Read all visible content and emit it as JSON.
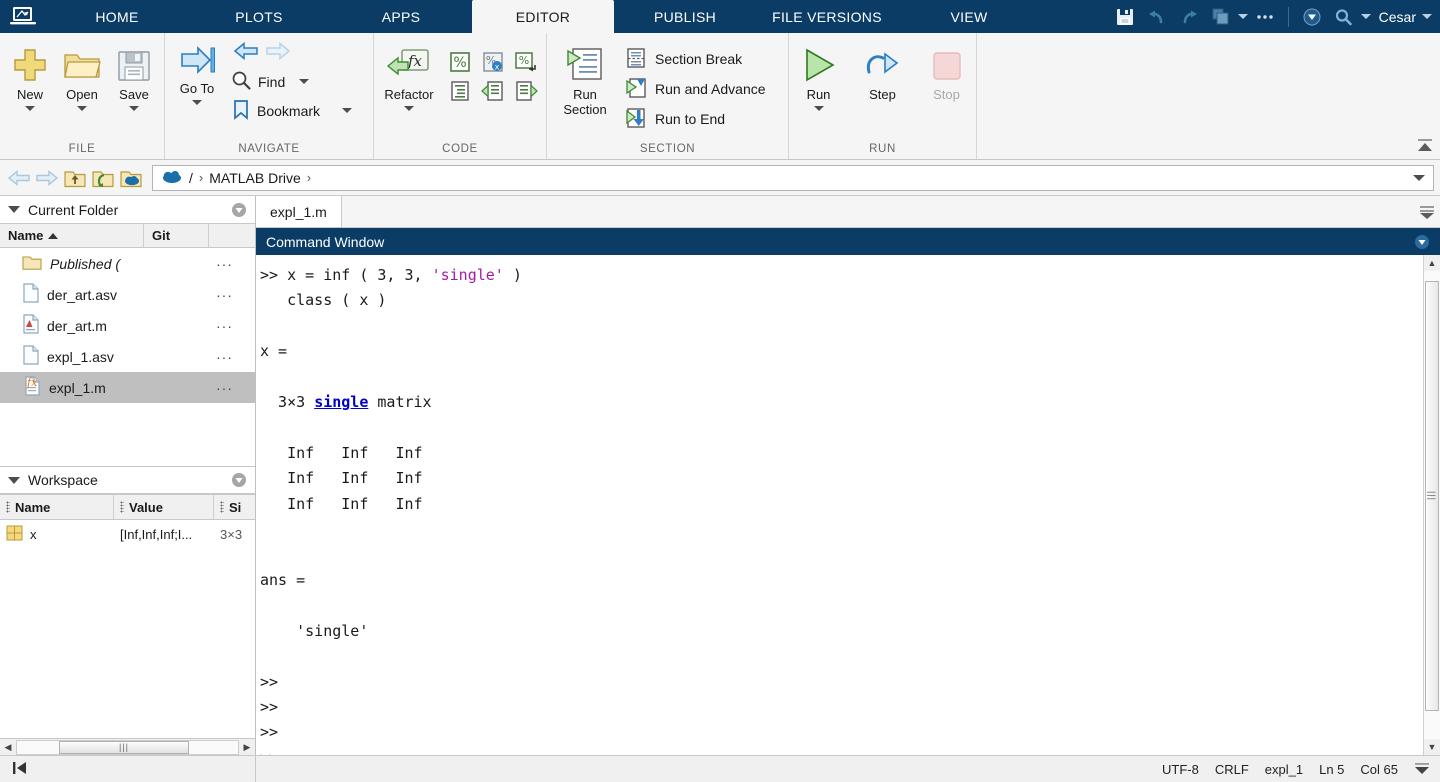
{
  "titlebar": {
    "logo_icon": "matlab-logo-icon",
    "tabs": [
      {
        "label": "HOME",
        "key": "home",
        "active": false
      },
      {
        "label": "PLOTS",
        "key": "plots",
        "active": false
      },
      {
        "label": "APPS",
        "key": "apps",
        "active": false
      },
      {
        "label": "EDITOR",
        "key": "editor",
        "active": true
      },
      {
        "label": "PUBLISH",
        "key": "publish",
        "active": false
      },
      {
        "label": "FILE VERSIONS",
        "key": "fileversions",
        "active": false
      },
      {
        "label": "VIEW",
        "key": "view",
        "active": false
      }
    ],
    "quick_icons": [
      "save-icon",
      "undo-icon",
      "redo-icon",
      "layout-icon",
      "overflow-icon",
      "help-icon",
      "search-icon"
    ],
    "user": "Cesar"
  },
  "ribbon": {
    "groups": [
      {
        "label": "FILE",
        "buttons": [
          {
            "label": "New",
            "icon": "new-plus-icon",
            "has_menu": true
          },
          {
            "label": "Open",
            "icon": "open-folder-icon",
            "has_menu": true
          },
          {
            "label": "Save",
            "icon": "save-floppy-icon",
            "has_menu": true
          }
        ]
      },
      {
        "label": "NAVIGATE",
        "back_icon": "back-arrow-icon",
        "forward_icon": "forward-arrow-icon",
        "items": [
          {
            "label": "Find",
            "icon": "find-magnifier-icon",
            "has_menu": true
          },
          {
            "label": "Bookmark",
            "icon": "bookmark-icon",
            "has_menu": true
          }
        ]
      },
      {
        "label": "CODE",
        "buttons": [
          {
            "label": "Refactor",
            "icon": "refactor-fx-icon",
            "has_menu": true
          }
        ],
        "grid_icons": [
          "comment-icon",
          "uncomment-icon",
          "wrap-comment-icon",
          "smart-indent-icon",
          "increase-indent-icon",
          "decrease-indent-icon"
        ]
      },
      {
        "label": "SECTION",
        "buttons": [
          {
            "label": "Run Section",
            "icon": "run-section-icon",
            "has_menu": false
          }
        ],
        "items": [
          {
            "label": "Section Break",
            "icon": "section-break-icon"
          },
          {
            "label": "Run and Advance",
            "icon": "run-and-advance-icon"
          },
          {
            "label": "Run to End",
            "icon": "run-to-end-icon"
          }
        ]
      },
      {
        "label": "RUN",
        "buttons": [
          {
            "label": "Run",
            "icon": "run-play-icon",
            "has_menu": true,
            "disabled": false
          },
          {
            "label": "Step",
            "icon": "step-icon",
            "has_menu": false,
            "disabled": false
          },
          {
            "label": "Stop",
            "icon": "stop-icon",
            "has_menu": false,
            "disabled": true
          }
        ]
      }
    ],
    "collapse_icon": "ribbon-collapse-icon"
  },
  "addressbar": {
    "nav_icons": [
      "back-arrow-icon",
      "forward-arrow-icon",
      "up-folder-icon",
      "browse-folder-icon",
      "cloud-folder-icon"
    ],
    "crumb_icon": "cloud-icon",
    "crumbs": [
      "/",
      "MATLAB Drive"
    ],
    "separator": "›"
  },
  "current_folder": {
    "title": "Current Folder",
    "action_icon": "panel-menu-icon",
    "columns": [
      "Name",
      "Git",
      ""
    ],
    "sort_column": "Name",
    "sort_direction": "asc",
    "rows": [
      {
        "name": "Published (",
        "icon": "folder-icon",
        "italic": true,
        "selected": false,
        "menu": "···"
      },
      {
        "name": "der_art.asv",
        "icon": "file-blank-icon",
        "italic": false,
        "selected": false,
        "menu": "···"
      },
      {
        "name": "der_art.m",
        "icon": "file-m-icon",
        "italic": false,
        "selected": false,
        "menu": "···"
      },
      {
        "name": "expl_1.asv",
        "icon": "file-blank-icon",
        "italic": false,
        "selected": false,
        "menu": "···"
      },
      {
        "name": "expl_1.m",
        "icon": "file-fx-icon",
        "italic": false,
        "selected": true,
        "menu": "···"
      }
    ]
  },
  "workspace": {
    "title": "Workspace",
    "action_icon": "panel-menu-icon",
    "columns": [
      "Name",
      "Value",
      "Si"
    ],
    "rows": [
      {
        "name": "x",
        "icon": "matrix-icon",
        "value": "[Inf,Inf,Inf;I...",
        "size": "3×3"
      }
    ]
  },
  "editor": {
    "tabs": [
      {
        "label": "expl_1.m",
        "active": true
      }
    ],
    "collapse_icon": "editor-collapse-icon"
  },
  "command_window": {
    "title": "Command Window",
    "action_icon": "panel-menu-icon",
    "lines": [
      {
        "segments": [
          {
            "t": ">> x = inf ( 3, 3, ",
            "c": "plain"
          },
          {
            "t": "'single'",
            "c": "str"
          },
          {
            "t": " )",
            "c": "plain"
          }
        ]
      },
      {
        "segments": [
          {
            "t": "   class ( x )",
            "c": "plain"
          }
        ]
      },
      {
        "segments": [
          {
            "t": "",
            "c": "plain"
          }
        ]
      },
      {
        "segments": [
          {
            "t": "x =",
            "c": "plain"
          }
        ]
      },
      {
        "segments": [
          {
            "t": "",
            "c": "plain"
          }
        ]
      },
      {
        "segments": [
          {
            "t": "  3×3 ",
            "c": "plain"
          },
          {
            "t": "single",
            "c": "lnk"
          },
          {
            "t": " matrix",
            "c": "plain"
          }
        ]
      },
      {
        "segments": [
          {
            "t": "",
            "c": "plain"
          }
        ]
      },
      {
        "segments": [
          {
            "t": "   Inf   Inf   Inf",
            "c": "plain"
          }
        ]
      },
      {
        "segments": [
          {
            "t": "   Inf   Inf   Inf",
            "c": "plain"
          }
        ]
      },
      {
        "segments": [
          {
            "t": "   Inf   Inf   Inf",
            "c": "plain"
          }
        ]
      },
      {
        "segments": [
          {
            "t": "",
            "c": "plain"
          }
        ]
      },
      {
        "segments": [
          {
            "t": "",
            "c": "plain"
          }
        ]
      },
      {
        "segments": [
          {
            "t": "ans =",
            "c": "plain"
          }
        ]
      },
      {
        "segments": [
          {
            "t": "",
            "c": "plain"
          }
        ]
      },
      {
        "segments": [
          {
            "t": "    'single'",
            "c": "plain"
          }
        ]
      },
      {
        "segments": [
          {
            "t": "",
            "c": "plain"
          }
        ]
      },
      {
        "segments": [
          {
            "t": ">>",
            "c": "plain"
          }
        ]
      },
      {
        "segments": [
          {
            "t": ">>",
            "c": "plain"
          }
        ]
      },
      {
        "segments": [
          {
            "t": ">>",
            "c": "plain"
          }
        ]
      },
      {
        "segments": [
          {
            "t": ">>",
            "c": "plain"
          }
        ]
      }
    ]
  },
  "statusbar": {
    "start_icon": "go-to-start-icon",
    "encoding": "UTF-8",
    "line_ending": "CRLF",
    "file": "expl_1",
    "line": "Ln 5",
    "column": "Col 65",
    "collapse_icon": "statusbar-collapse-icon"
  },
  "colors": {
    "brand_dark": "#0b3c66",
    "brand_blue": "#1b75bb",
    "ribbon_bg": "#f5f5f5",
    "selection": "#bfbfbf",
    "string_purple": "#a619a6",
    "link_blue": "#0000c8"
  }
}
